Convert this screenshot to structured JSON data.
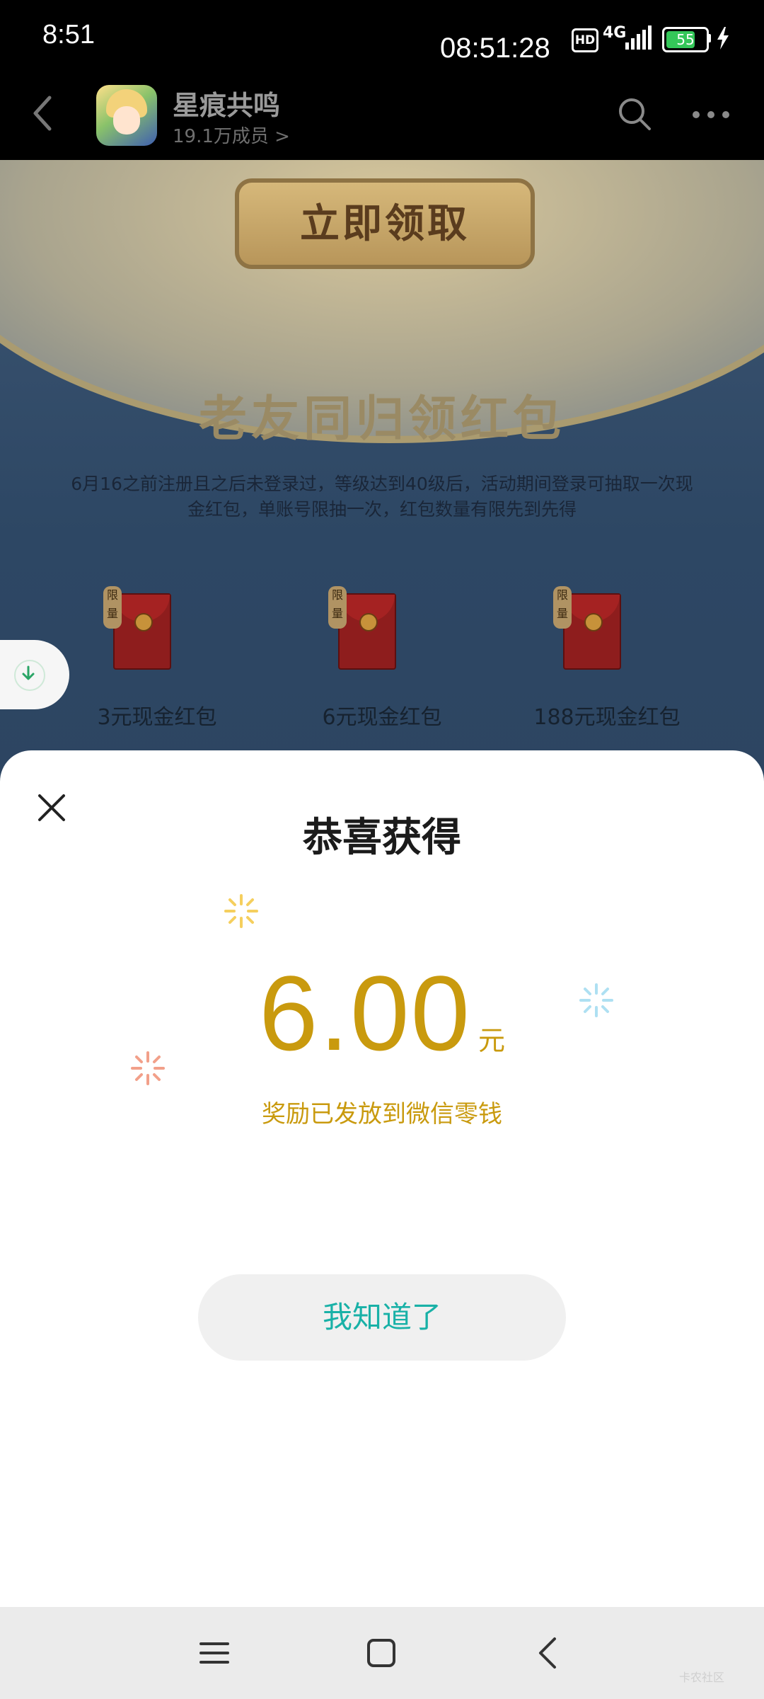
{
  "status_bar": {
    "time": "8:51",
    "clock": "08:51:28",
    "hd": "HD",
    "network": "4G",
    "battery": "55"
  },
  "header": {
    "app_name": "星痕共鸣",
    "members": "19.1万成员 >"
  },
  "banner": {
    "claim_button": "立即领取",
    "event_title": "老友同归领红包",
    "event_desc": "6月16之前注册且之后未登录过，等级达到40级后，活动期间登录可抽取一次现金红包，单账号限抽一次，红包数量有限先到先得",
    "limit_tag": "限量",
    "rewards": [
      {
        "label": "3元现金红包"
      },
      {
        "label": "6元现金红包"
      },
      {
        "label": "188元现金红包"
      }
    ]
  },
  "dialog": {
    "title": "恭喜获得",
    "amount": "6.00",
    "unit": "元",
    "note": "奖励已发放到微信零钱",
    "confirm": "我知道了"
  },
  "watermark": "卡农社区",
  "colors": {
    "amount": "#c99a0e",
    "confirm_text": "#19b1a7",
    "dialog_bg": "#ffffff"
  }
}
